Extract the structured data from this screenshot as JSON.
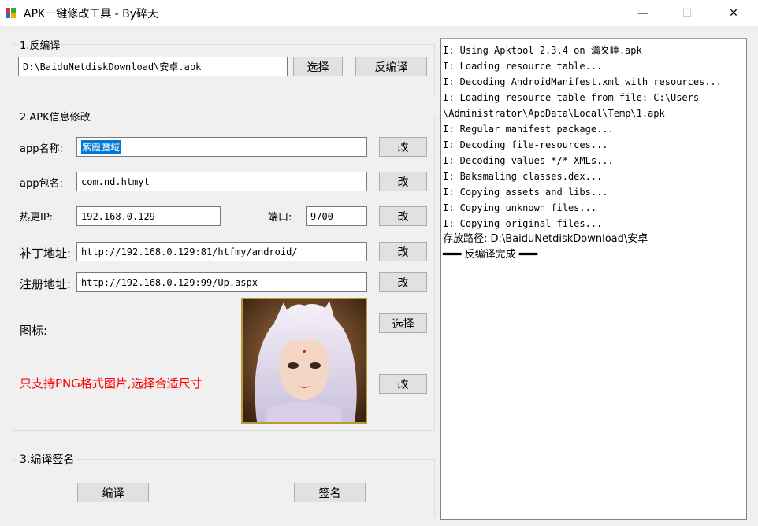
{
  "window": {
    "title": "APK一键修改工具 - By碎天",
    "minimize": "—",
    "maximize": "☐",
    "close": "✕"
  },
  "decompile_group": {
    "legend": "1.反编译",
    "path_value": "D:\\BaiduNetdiskDownload\\安卓.apk",
    "select_label": "选择",
    "decompile_label": "反编译"
  },
  "info_group": {
    "legend": "2.APK信息修改",
    "app_name": {
      "label": "app名称:",
      "value": "紫霞魔域",
      "button": "改"
    },
    "package_name": {
      "label": "app包名:",
      "value": "com.nd.htmyt",
      "button": "改"
    },
    "hot_ip": {
      "label": "热更IP:",
      "value": "192.168.0.129"
    },
    "port": {
      "label": "端口:",
      "value": "9700",
      "button": "改"
    },
    "patch_url": {
      "label": "补丁地址:",
      "value": "http://192.168.0.129:81/htfmy/android/",
      "button": "改"
    },
    "register_url": {
      "label": "注册地址:",
      "value": "http://192.168.0.129:99/Up.aspx",
      "button": "改"
    },
    "icon": {
      "label": "图标:",
      "select_button": "选择",
      "change_button": "改"
    },
    "warning": "只支持PNG格式图片,选择合适尺寸"
  },
  "sign_group": {
    "legend": "3.编译签名",
    "compile_label": "编译",
    "sign_label": "签名"
  },
  "log": {
    "lines": [
      "I: Using Apktool 2.3.4 on 瀹夊崜.apk",
      "I: Loading resource table...",
      "I: Decoding AndroidManifest.xml with resources...",
      "I: Loading resource table from file: C:\\Users",
      "\\Administrator\\AppData\\Local\\Temp\\1.apk",
      "I: Regular manifest package...",
      "I: Decoding file-resources...",
      "I: Decoding values */* XMLs...",
      "I: Baksmaling classes.dex...",
      "I: Copying assets and libs...",
      "I: Copying unknown files...",
      "I: Copying original files...",
      "存放路径: D:\\BaiduNetdiskDownload\\安卓",
      "═══ 反编译完成 ═══"
    ]
  },
  "colors": {
    "window_bg": "#f0f0f0",
    "selection": "#0078d7",
    "warning_text": "#ff0000",
    "icon_border": "#b89a3a"
  }
}
